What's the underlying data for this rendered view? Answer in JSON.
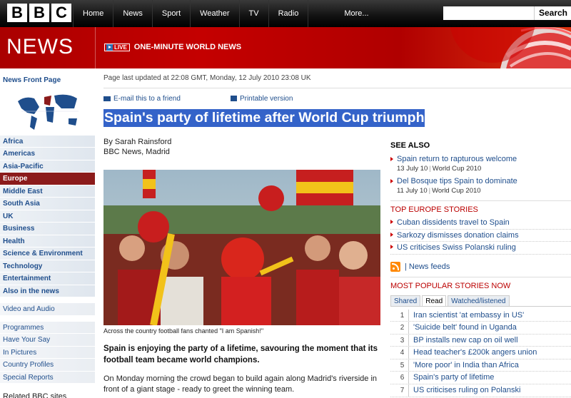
{
  "top_nav": {
    "logo_letters": [
      "B",
      "B",
      "C"
    ],
    "items": [
      "Home",
      "News",
      "Sport",
      "Weather",
      "TV",
      "Radio",
      "More..."
    ],
    "search_placeholder": "",
    "search_button": "Search"
  },
  "banner": {
    "news_word": "NEWS",
    "live_badge": "LIVE",
    "live_text": "ONE-MINUTE WORLD NEWS"
  },
  "left_nav": {
    "front_page": "News Front Page",
    "regions": [
      "Africa",
      "Americas",
      "Asia-Pacific",
      "Europe",
      "Middle East",
      "South Asia",
      "UK",
      "Business",
      "Health",
      "Science & Environment",
      "Technology",
      "Entertainment",
      "Also in the news"
    ],
    "active": "Europe",
    "video_audio": "Video and Audio",
    "tools": [
      "Programmes",
      "Have Your Say",
      "In Pictures",
      "Country Profiles",
      "Special Reports"
    ],
    "related": "Related BBC sites"
  },
  "article": {
    "updated": "Page last updated at 22:08 GMT, Monday, 12 July 2010 23:08 UK",
    "email_link": "E-mail this to a friend",
    "print_link": "Printable version",
    "headline": "Spain's party of lifetime after World Cup triumph",
    "byline_author": "By Sarah Rainsford",
    "byline_source": "BBC News, Madrid",
    "caption": "Across the country football fans chanted \"I am Spanish!\"",
    "intro": "Spain is enjoying the party of a lifetime, savouring the moment that its football team became world champions.",
    "para1": "On Monday morning the crowd began to build again along Madrid's riverside in front of a giant stage - ready to greet the winning team."
  },
  "right": {
    "see_also_title": "SEE ALSO",
    "see_also": [
      {
        "title": "Spain return to rapturous welcome",
        "date": "13 July 10",
        "section": "World Cup 2010"
      },
      {
        "title": "Del Bosque tips Spain to dominate",
        "date": "11 July 10",
        "section": "World Cup 2010"
      }
    ],
    "top_title": "TOP EUROPE STORIES",
    "top_stories": [
      "Cuban dissidents travel to Spain",
      "Sarkozy dismisses donation claims",
      "US criticises Swiss Polanski ruling"
    ],
    "feeds": "| News feeds",
    "popular_title": "MOST POPULAR STORIES NOW",
    "tabs": [
      "Shared",
      "Read",
      "Watched/listened"
    ],
    "active_tab": "Read",
    "popular": [
      "Iran scientist 'at embassy in US'",
      "'Suicide belt' found in Uganda",
      "BP installs new cap on oil well",
      "Head teacher's £200k angers union",
      "'More poor' in India than Africa",
      "Spain's party of lifetime",
      "US criticises ruling on Polanski"
    ],
    "popular_nums": [
      "1",
      "2",
      "3",
      "4",
      "5",
      "6",
      "7"
    ]
  },
  "colors": {
    "bbc_red": "#b00000",
    "link_blue": "#1f4e8c",
    "active_nav": "#8b1b1b",
    "headline_highlight": "#3463c9"
  }
}
